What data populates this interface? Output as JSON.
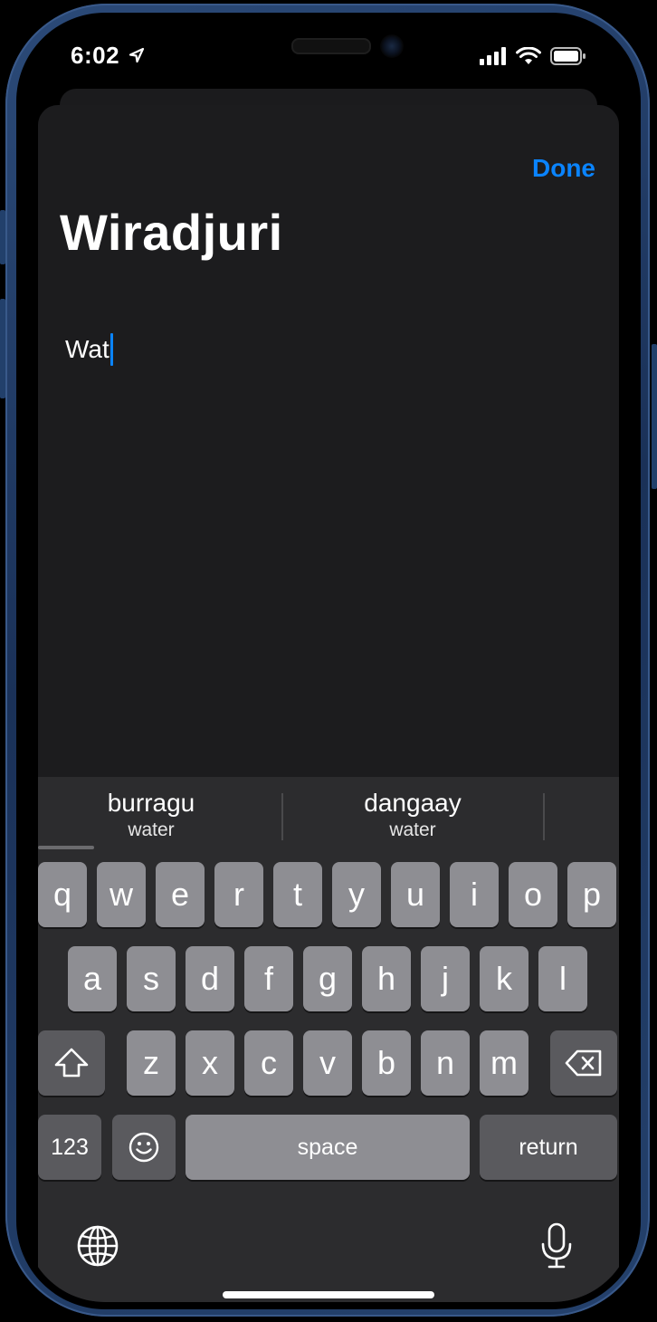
{
  "status_bar": {
    "time": "6:02"
  },
  "sheet": {
    "done_label": "Done",
    "title": "Wiradjuri",
    "input_text": "Wat"
  },
  "suggestions": [
    {
      "word": "burragu",
      "translation": "water"
    },
    {
      "word": "dangaay",
      "translation": "water"
    }
  ],
  "keyboard": {
    "row1": [
      "q",
      "w",
      "e",
      "r",
      "t",
      "y",
      "u",
      "i",
      "o",
      "p"
    ],
    "row2": [
      "a",
      "s",
      "d",
      "f",
      "g",
      "h",
      "j",
      "k",
      "l"
    ],
    "row3": [
      "z",
      "x",
      "c",
      "v",
      "b",
      "n",
      "m"
    ],
    "numbers_label": "123",
    "space_label": "space",
    "return_label": "return"
  },
  "icons": {
    "location": "location-arrow-icon",
    "signal": "cellular-signal-icon",
    "wifi": "wifi-icon",
    "battery": "battery-icon",
    "shift": "shift-icon",
    "backspace": "backspace-icon",
    "emoji": "emoji-icon",
    "globe": "globe-icon",
    "microphone": "microphone-icon"
  },
  "colors": {
    "accent": "#0a84ff",
    "sheet_background": "#1c1c1e",
    "keyboard_background": "#2c2c2e",
    "letter_key": "#8e8e93",
    "function_key": "#5a5a5e",
    "frame": "#1a3158"
  }
}
